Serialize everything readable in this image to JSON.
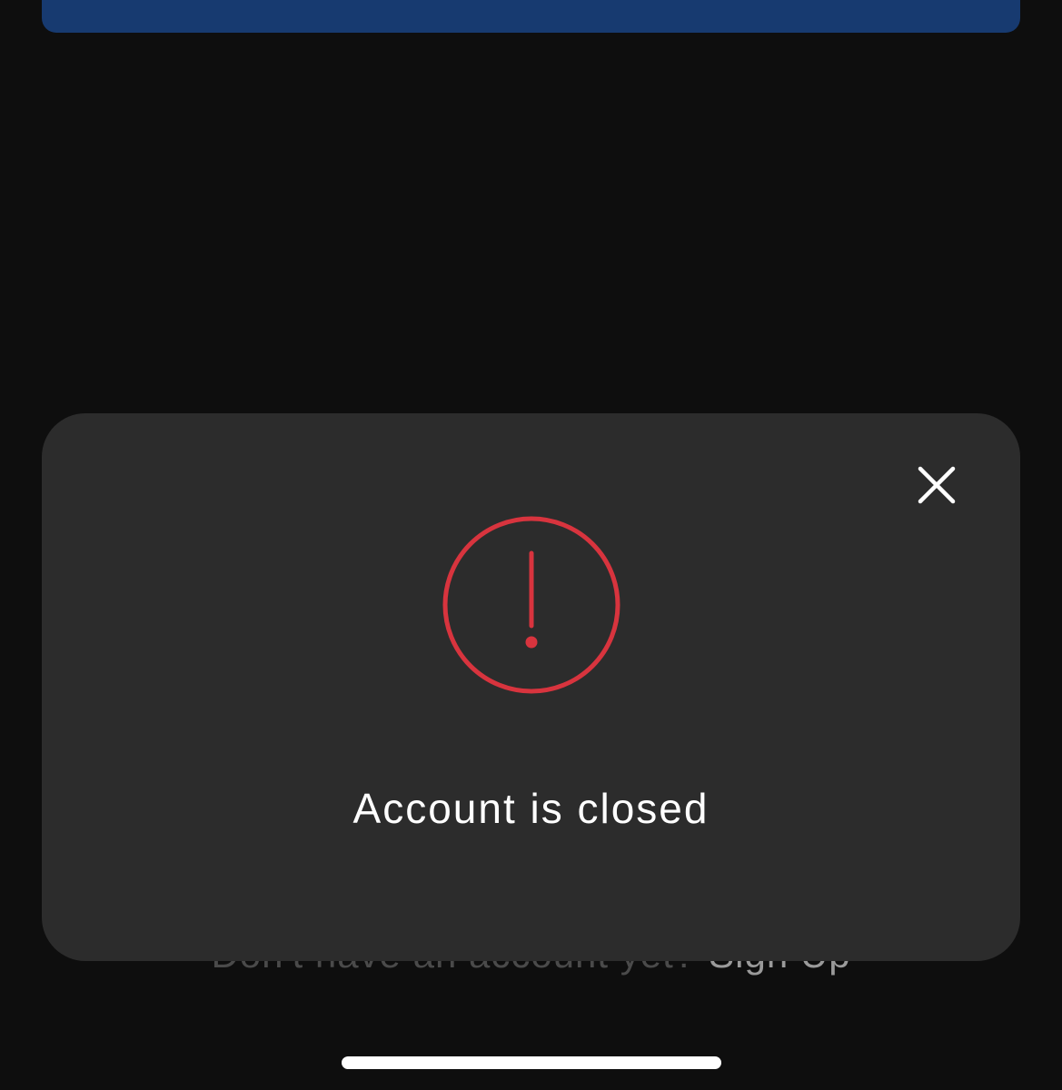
{
  "background": {
    "signup_prompt": "Don't have an account yet?",
    "signup_link": "Sign Up"
  },
  "modal": {
    "message": "Account is closed",
    "icon": "alert-circle-icon",
    "close_icon": "close-icon"
  },
  "colors": {
    "background": "#0e0e0e",
    "modal": "#2c2c2c",
    "primary_button": "#173a70",
    "alert": "#d8343e",
    "text": "#ffffff"
  }
}
